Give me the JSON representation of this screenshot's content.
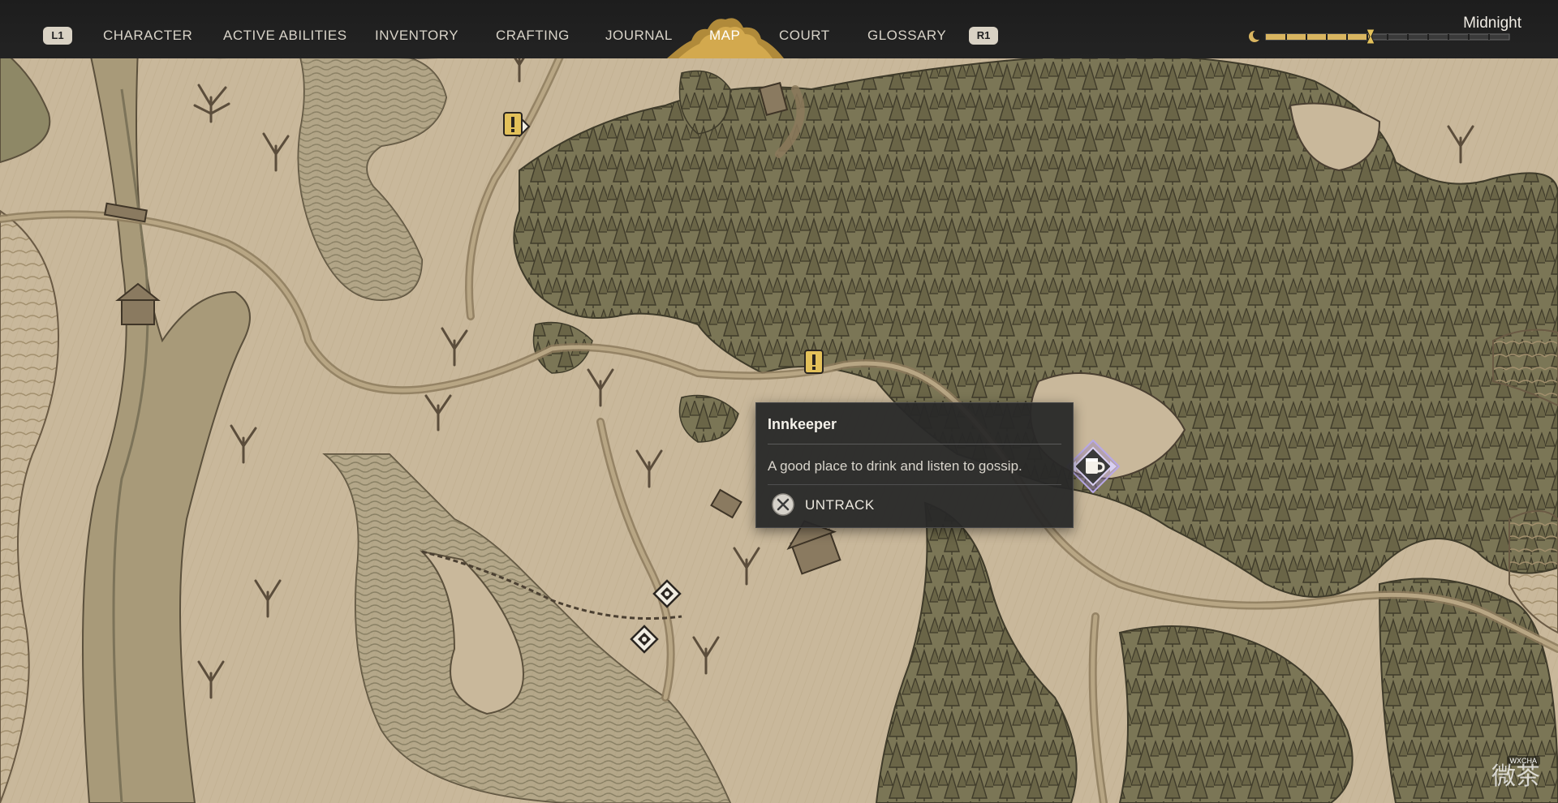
{
  "nav": {
    "left_button": "L1",
    "right_button": "R1",
    "tabs": [
      {
        "label": "CHARACTER"
      },
      {
        "label": "ACTIVE ABILITIES"
      },
      {
        "label": "INVENTORY"
      },
      {
        "label": "CRAFTING"
      },
      {
        "label": "JOURNAL"
      },
      {
        "label": "MAP"
      },
      {
        "label": "COURT"
      },
      {
        "label": "GLOSSARY"
      }
    ],
    "active_tab": "MAP"
  },
  "time_of_day": {
    "label": "Midnight",
    "icon": "moon-icon",
    "progress": 0.43
  },
  "tooltip": {
    "title": "Innkeeper",
    "description": "A good place to drink and listen to gossip.",
    "action_label": "UNTRACK",
    "action_icon": "cross-button-icon"
  },
  "markers": [
    {
      "type": "quest-marker",
      "icon": "exclamation-icon"
    },
    {
      "type": "quest-marker",
      "icon": "exclamation-icon"
    },
    {
      "type": "innkeeper-marker",
      "icon": "mug-icon",
      "tracked": true
    },
    {
      "type": "point-of-interest",
      "icon": "diamond-icon"
    },
    {
      "type": "point-of-interest",
      "icon": "diamond-icon"
    }
  ],
  "watermark": {
    "text": "微茶",
    "tag": "WXCHA"
  },
  "colors": {
    "parchment": "#c9b89b",
    "forest": "#6e6a4e",
    "ink": "#4a3f31",
    "water": "#9c9274",
    "topbar": "#1f1f1f",
    "accent_gold": "#d9b560",
    "tooltip_bg": "#2a2a2a"
  }
}
